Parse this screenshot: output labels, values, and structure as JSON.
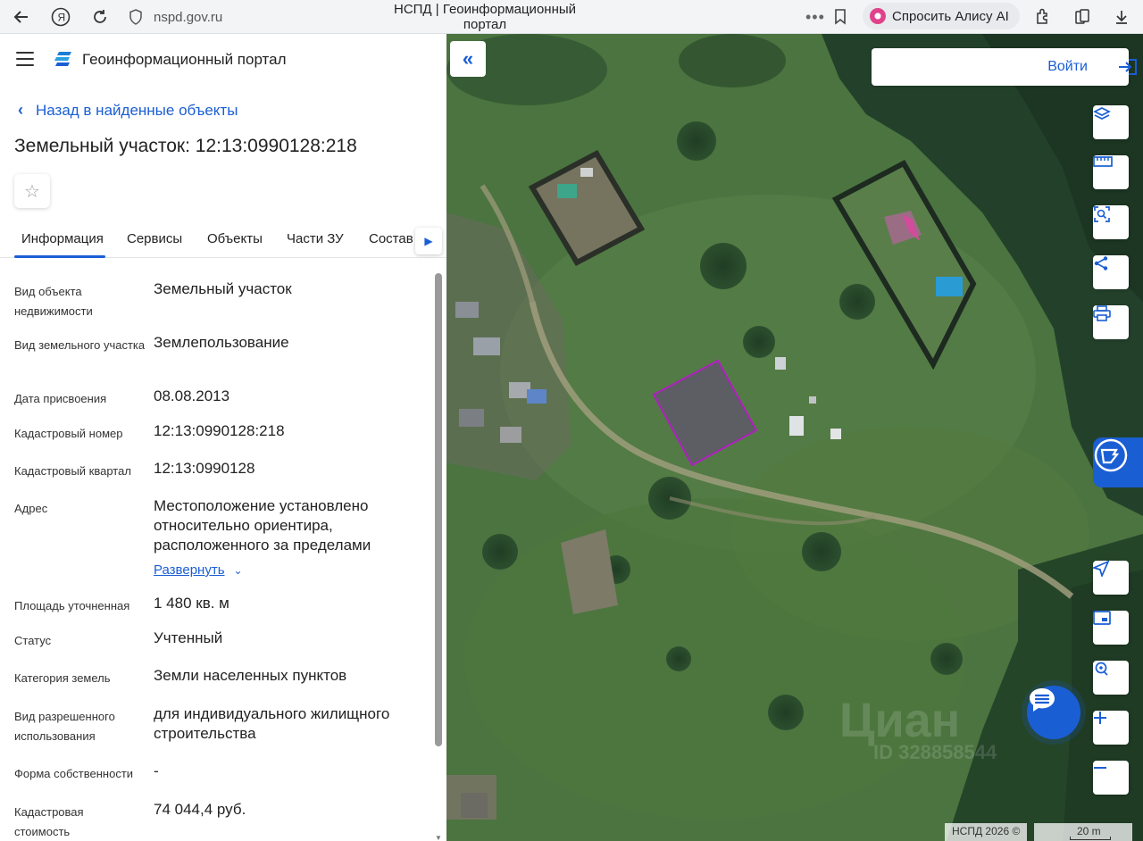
{
  "browser": {
    "url": "nspd.gov.ru",
    "page_title": "НСПД | Геоинформационный портал",
    "alice_label": "Спросить Алису AI",
    "menu_dots": "•••"
  },
  "portal": {
    "name": "Геоинформационный портал",
    "back_link": "Назад в найденные объекты",
    "object_title": "Земельный участок: 12:13:0990128:218"
  },
  "tabs": [
    {
      "label": "Информация"
    },
    {
      "label": "Сервисы"
    },
    {
      "label": "Объекты"
    },
    {
      "label": "Части ЗУ"
    },
    {
      "label": "Состав"
    }
  ],
  "properties": [
    {
      "label": "Вид объекта недвижимости",
      "value": "Земельный участок"
    },
    {
      "label": "Вид земельного участка",
      "value": "Землепользование"
    },
    {
      "label": "Дата присвоения",
      "value": "08.08.2013"
    },
    {
      "label": "Кадастровый номер",
      "value": "12:13:0990128:218"
    },
    {
      "label": "Кадастровый квартал",
      "value": "12:13:0990128"
    },
    {
      "label": "Адрес",
      "value": "Местоположение установлено относительно ориентира, расположенного за пределами"
    },
    {
      "label": "Площадь уточненная",
      "value": "1 480 кв. м"
    },
    {
      "label": "Статус",
      "value": "Учтенный"
    },
    {
      "label": "Категория земель",
      "value": "Земли населенных пунктов"
    },
    {
      "label": "Вид разрешенного использования",
      "value": "для индивидуального жилищного строительства"
    },
    {
      "label": "Форма собственности",
      "value": "-"
    },
    {
      "label": "Кадастровая стоимость",
      "value": "74 044,4 руб."
    }
  ],
  "expand_label": "Развернуть",
  "map": {
    "login_label": "Войти",
    "watermark": "Циан",
    "watermark_id": "ID 328858544",
    "copyright": "НСПД 2026 ©",
    "scale_label": "20 m",
    "parcel_color": "#b020c0",
    "accent": "#1a5ed4"
  }
}
